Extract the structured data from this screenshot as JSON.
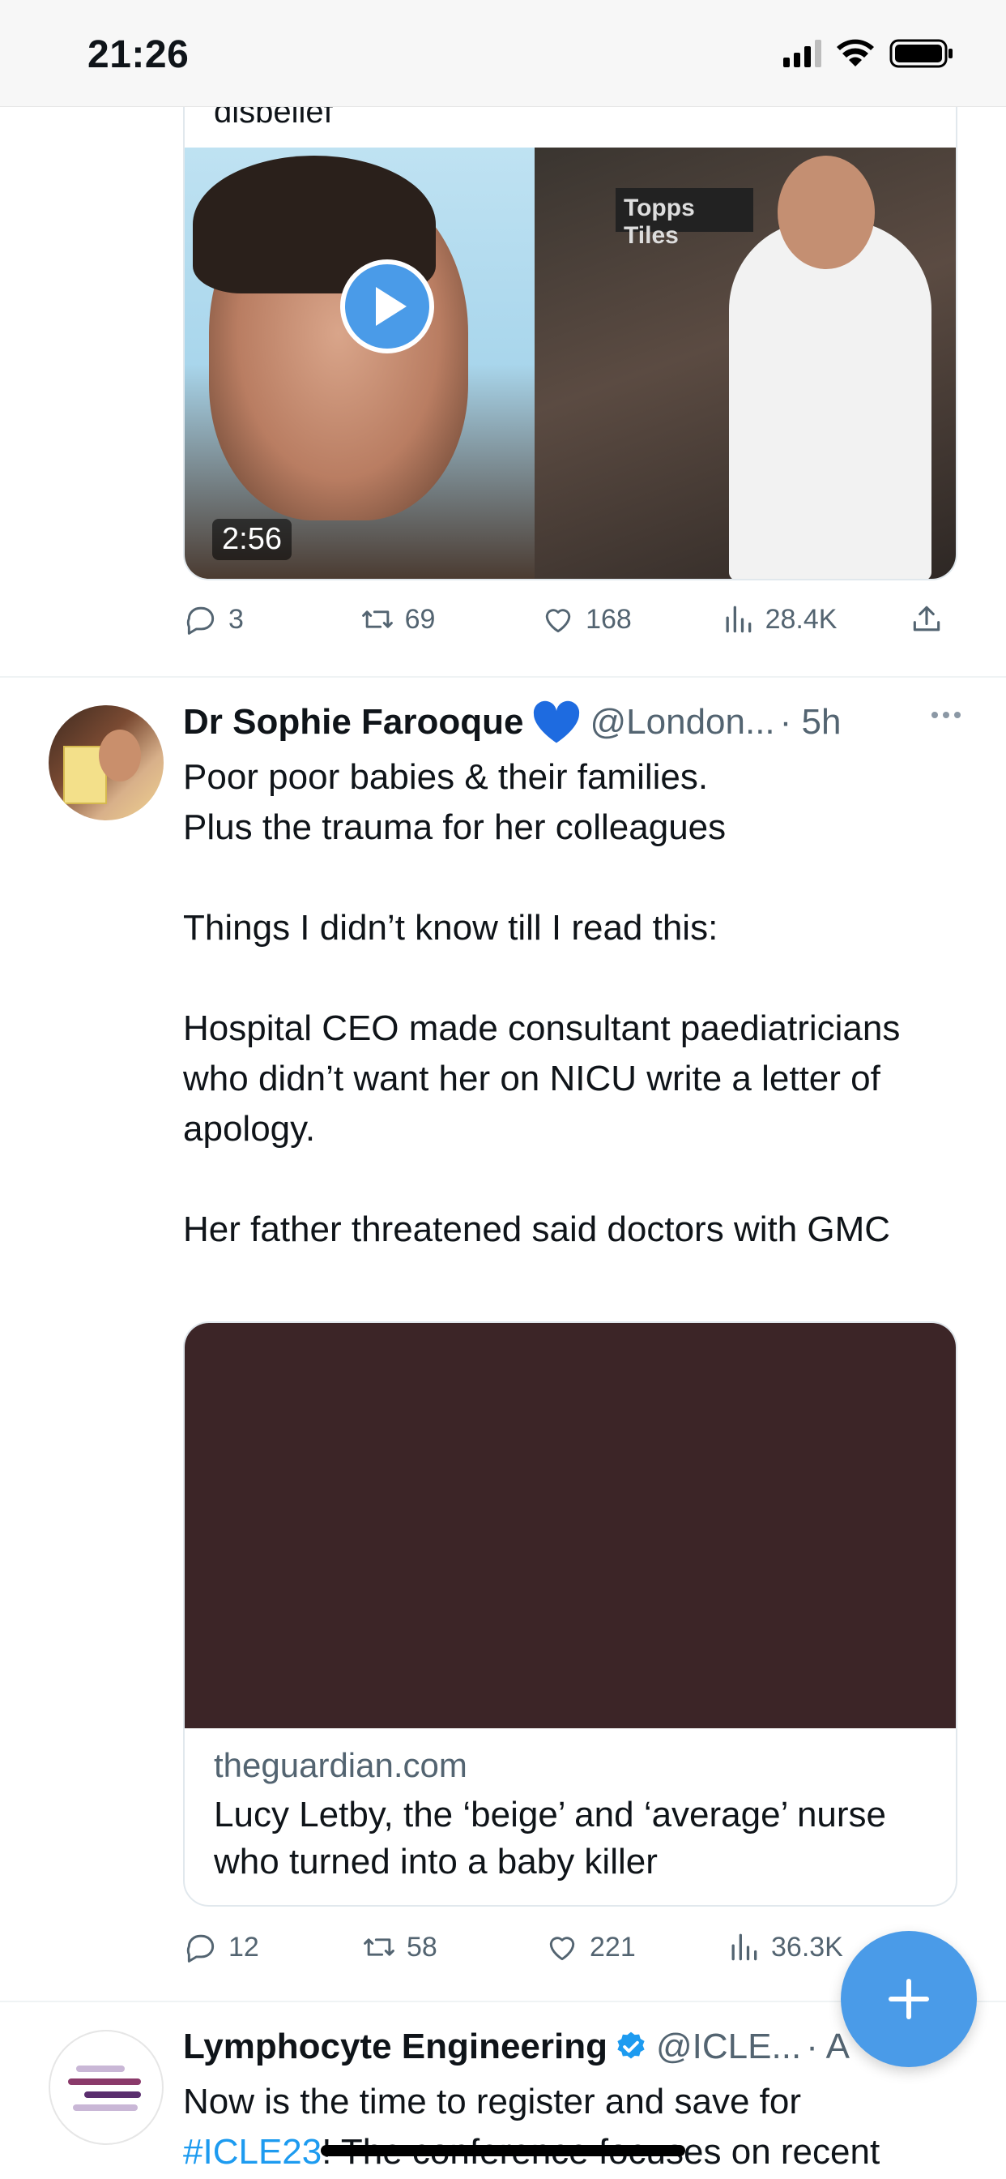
{
  "status_bar": {
    "time": "21:26",
    "icons": [
      "signal-icon",
      "wifi-icon",
      "battery-icon"
    ]
  },
  "tweet_prev": {
    "cut_text": "disbelief",
    "video_duration": "2:56",
    "sign_text": "Topps Tiles",
    "stats": {
      "replies": "3",
      "retweets": "69",
      "likes": "168",
      "views": "28.4K"
    }
  },
  "tweet_main": {
    "name": "Dr Sophie Farooque",
    "badge": "blue-heart",
    "handle": "@London...",
    "time": "· 5h",
    "body": "Poor poor babies & their families.\nPlus the trauma for her colleagues\n\nThings I didn’t know till I read this:\n\nHospital CEO made consultant paediatricians who didn’t want her on NICU write a letter of apology.\n\nHer father threatened said doctors with GMC",
    "link_card": {
      "domain": "theguardian.com",
      "title": "Lucy Letby, the ‘beige’ and ‘average’ nurse who turned into a baby killer",
      "image_color": "#3c2527"
    },
    "stats": {
      "replies": "12",
      "retweets": "58",
      "likes": "221",
      "views": "36.3K"
    }
  },
  "tweet_next": {
    "name": "Lymphocyte Engineering",
    "handle": "@ICLE...",
    "time": "· A",
    "body_line1": "Now is the time to register and save for",
    "hashtag": "#ICLE23",
    "body_rest": "! The conference focuses on recent"
  },
  "colors": {
    "accent": "#1d9bf0",
    "fab": "#4a9be8",
    "secondary_text": "#536471"
  }
}
